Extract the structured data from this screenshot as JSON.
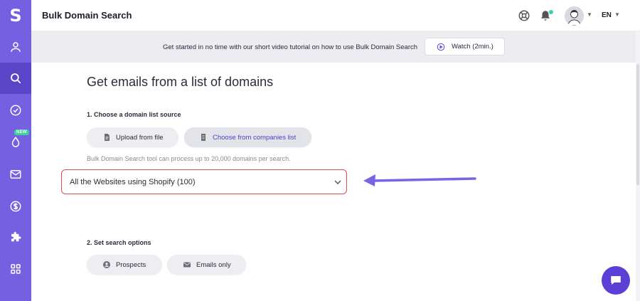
{
  "app": {
    "logo_letter": "S"
  },
  "sidebar": {
    "items": [
      {
        "icon": "user-icon"
      },
      {
        "icon": "search-icon",
        "active": true
      },
      {
        "icon": "check-circle-icon"
      },
      {
        "icon": "drop-icon",
        "badge": "NEW"
      },
      {
        "icon": "mail-icon"
      },
      {
        "icon": "dollar-icon"
      },
      {
        "icon": "puzzle-icon"
      },
      {
        "icon": "grid-icon"
      }
    ]
  },
  "header": {
    "title": "Bulk Domain Search",
    "language": "EN"
  },
  "banner": {
    "text": "Get started in no time with our short video tutorial on how to use Bulk Domain Search",
    "watch_label": "Watch (2min.)"
  },
  "main": {
    "title": "Get emails from a list of domains",
    "step1_label": "1. Choose a domain list source",
    "source_options": [
      {
        "label": "Upload from file",
        "selected": false
      },
      {
        "label": "Choose from companies list",
        "selected": true
      }
    ],
    "note": "Bulk Domain Search tool can process up to 20,000 domains per search.",
    "selected_list": "All the Websites using Shopify (100)",
    "step2_label": "2. Set search options",
    "search_options": [
      {
        "label": "Prospects"
      },
      {
        "label": "Emails only"
      }
    ]
  },
  "colors": {
    "sidebar": "#7460e0",
    "sidebar_active": "#5a45c9",
    "accent": "#5b3fd6",
    "highlight_border": "#e04b4b",
    "annotation_arrow": "#7b63e6",
    "notification_dot": "#3bd1b5"
  }
}
